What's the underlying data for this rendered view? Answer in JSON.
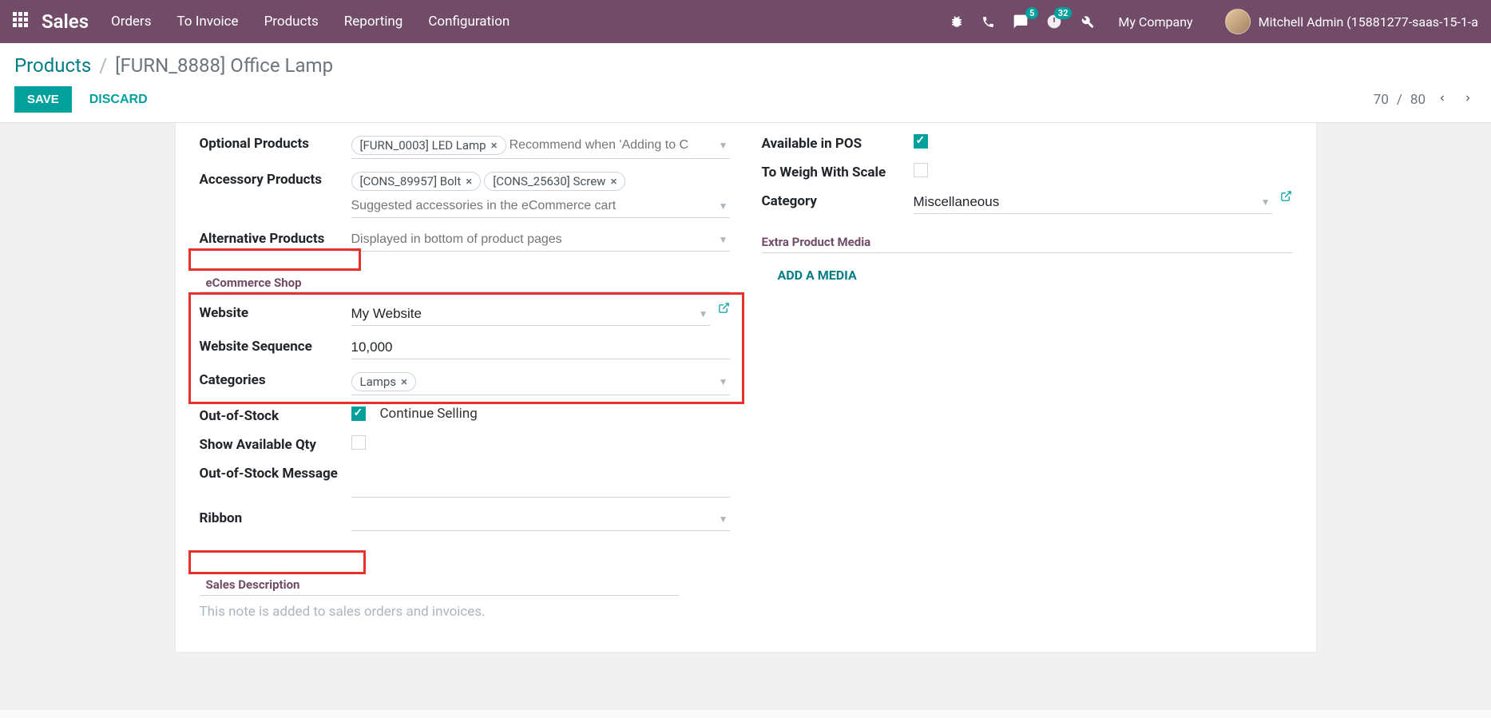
{
  "navbar": {
    "brand": "Sales",
    "links": [
      "Orders",
      "To Invoice",
      "Products",
      "Reporting",
      "Configuration"
    ],
    "msg_badge": "5",
    "activity_badge": "32",
    "company": "My Company",
    "user": "Mitchell Admin (15881277-saas-15-1-a"
  },
  "breadcrumb": {
    "root": "Products",
    "current": "[FURN_8888] Office Lamp"
  },
  "actions": {
    "save": "SAVE",
    "discard": "DISCARD",
    "page_current": "70",
    "page_total": "80"
  },
  "left": {
    "optional_label": "Optional Products",
    "optional_tags": [
      "[FURN_0003] LED Lamp"
    ],
    "optional_placeholder": "Recommend when 'Adding to C",
    "accessory_label": "Accessory Products",
    "accessory_tags": [
      "[CONS_89957] Bolt",
      "[CONS_25630] Screw"
    ],
    "accessory_placeholder": "Suggested accessories in the eCommerce cart",
    "alternative_label": "Alternative Products",
    "alternative_placeholder": "Displayed in bottom of product pages",
    "ecom_section": "eCommerce Shop",
    "website_label": "Website",
    "website_value": "My Website",
    "wseq_label": "Website Sequence",
    "wseq_value": "10,000",
    "categories_label": "Categories",
    "categories_tags": [
      "Lamps"
    ],
    "oos_label": "Out-of-Stock",
    "oos_chk_label": "Continue Selling",
    "show_qty_label": "Show Available Qty",
    "oos_msg_label": "Out-of-Stock Message",
    "ribbon_label": "Ribbon",
    "sales_desc_section": "Sales Description",
    "sales_desc_placeholder": "This note is added to sales orders and invoices."
  },
  "right": {
    "pos_label": "Available in POS",
    "weigh_label": "To Weigh With Scale",
    "category_label": "Category",
    "category_value": "Miscellaneous",
    "extra_media_section": "Extra Product Media",
    "add_media": "ADD A MEDIA"
  }
}
